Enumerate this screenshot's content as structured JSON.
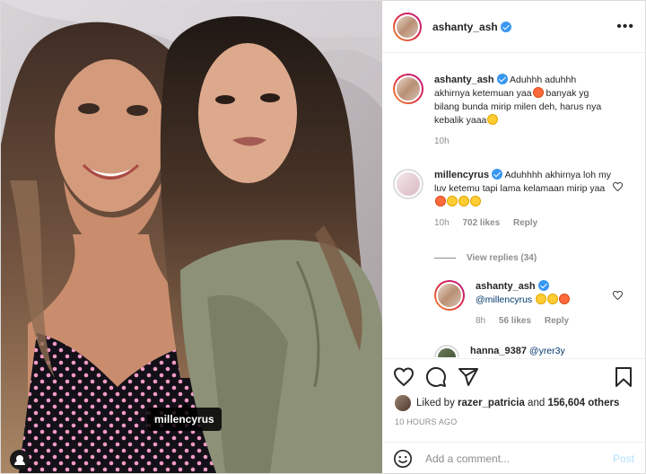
{
  "photo": {
    "tag_label": "millencyrus",
    "user_tag_icon": "person-icon"
  },
  "header": {
    "username": "ashanty_ash",
    "verified": true,
    "more_icon": "ellipsis-icon"
  },
  "comments": [
    {
      "username": "ashanty_ash",
      "verified": true,
      "text_1": "Aduhhh aduhhh akhirnya ketemuan yaa",
      "text_2": " banyak yg bilang bunda mirip milen deh, harus nya kebalik yaaa",
      "time": "10h"
    },
    {
      "username": "millencyrus",
      "verified": true,
      "text": "Aduhhhh akhirnya loh my luv ketemu tapi lama kelamaan mirip yaa",
      "time": "10h",
      "likes": "702 likes",
      "reply": "Reply",
      "view_replies": "View replies (34)"
    },
    {
      "username": "ashanty_ash",
      "verified": true,
      "mention": "@millencyrus",
      "time": "8h",
      "likes": "56 likes",
      "reply": "Reply"
    },
    {
      "username": "hanna_9387",
      "mention": "@yrer3y"
    }
  ],
  "actions": {
    "icons": [
      "heart-icon",
      "comment-icon",
      "share-icon",
      "bookmark-icon"
    ],
    "liked_by_prefix": "Liked by ",
    "liked_by_user": "razer_patricia",
    "liked_by_and": " and ",
    "liked_by_count": "156,604 others",
    "timestamp": "10 HOURS AGO"
  },
  "add_comment": {
    "placeholder": "Add a comment...",
    "post_label": "Post"
  },
  "colors": {
    "accent": "#3897f0",
    "muted": "#8e8e8e",
    "post_disabled": "#b2dffc"
  }
}
